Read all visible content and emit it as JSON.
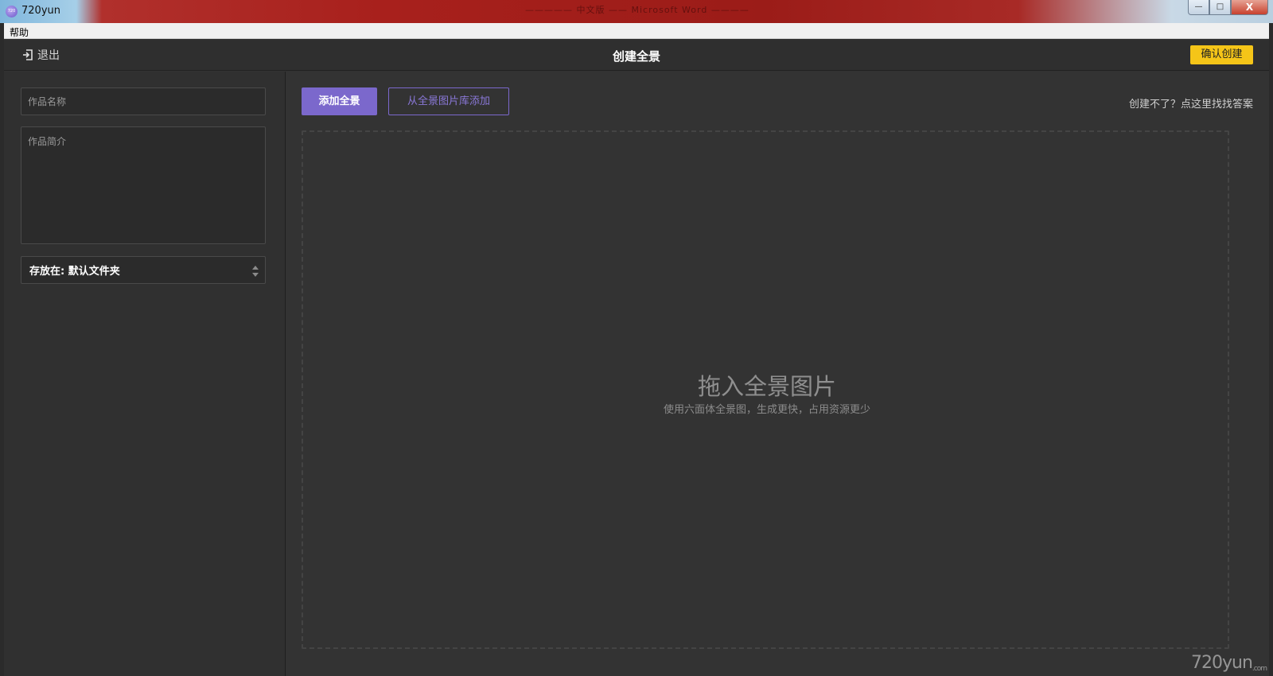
{
  "window": {
    "title": "720yun",
    "app_icon_text": "720",
    "background_text": "————— 中文版 —— Microsoft Word ————",
    "controls": {
      "minimize": "—",
      "maximize": "□",
      "close": "X"
    }
  },
  "menubar": {
    "items": [
      {
        "label": "帮助"
      }
    ]
  },
  "header": {
    "exit_label": "退出",
    "title": "创建全景",
    "confirm_label": "确认创建"
  },
  "sidebar": {
    "name_placeholder": "作品名称",
    "desc_placeholder": "作品简介",
    "folder_label": "存放在: 默认文件夹"
  },
  "main": {
    "add_panorama_label": "添加全景",
    "add_from_library_label": "从全景图片库添加",
    "help_link": "创建不了？点这里找找答案",
    "dropzone_title": "拖入全景图片",
    "dropzone_subtitle": "使用六面体全景图，生成更快，占用资源更少"
  },
  "watermark": {
    "main": "720yun",
    "suffix": ".com"
  },
  "colors": {
    "accent_purple": "#7b68cc",
    "confirm_yellow": "#f5c518",
    "panel_bg": "#333333"
  }
}
